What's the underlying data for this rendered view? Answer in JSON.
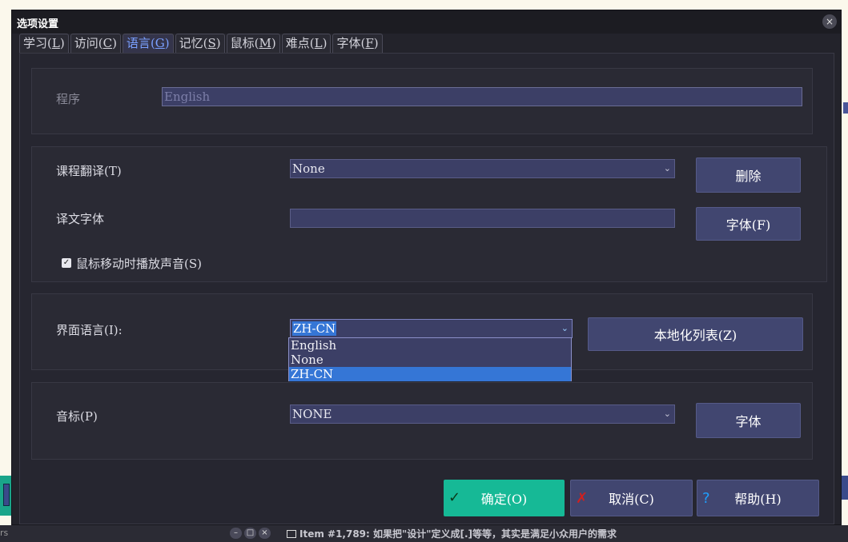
{
  "dialog": {
    "title": "选项设置",
    "close_label": "×"
  },
  "tabs": [
    {
      "label": "学习(L)",
      "text": "学习",
      "key": "L"
    },
    {
      "label": "访问(C)",
      "text": "访问",
      "key": "C"
    },
    {
      "label": "语言(G)",
      "text": "语言",
      "key": "G",
      "active": true
    },
    {
      "label": "记忆(S)",
      "text": "记忆",
      "key": "S"
    },
    {
      "label": "鼠标(M)",
      "text": "鼠标",
      "key": "M"
    },
    {
      "label": "难点(L)",
      "text": "难点",
      "key": "L"
    },
    {
      "label": "字体(F)",
      "text": "字体",
      "key": "F"
    }
  ],
  "program": {
    "label": "程序",
    "value": "English"
  },
  "course_translation": {
    "label": "课程翻译(T)",
    "value": "None",
    "delete_button": "删除"
  },
  "translation_font": {
    "label": "译文字体",
    "value": "",
    "font_button": "字体(F)"
  },
  "mouse_sound": {
    "label": "鼠标移动时播放声音(S)",
    "checked": true
  },
  "ui_language": {
    "label": "界面语言(I):",
    "value": "ZH-CN",
    "options": [
      "English",
      "None",
      "ZH-CN"
    ],
    "selected_index": 2,
    "localize_button": "本地化列表(Z)"
  },
  "phonetic": {
    "label": "音标(P)",
    "value": "NONE",
    "font_button": "字体"
  },
  "footer": {
    "ok": "确定(O)",
    "cancel": "取消(C)",
    "help": "帮助(H)"
  },
  "statusbar": {
    "left_text": "rs",
    "item_text": "Item #1,789: 如果把\"设计\"定义成[.]等等，其实是满足小众用户的需求"
  },
  "colors": {
    "ok_button": "#16b996",
    "selection": "#3576d6",
    "field_bg": "#3c3f66",
    "active_tab": "#7aa0ff"
  }
}
